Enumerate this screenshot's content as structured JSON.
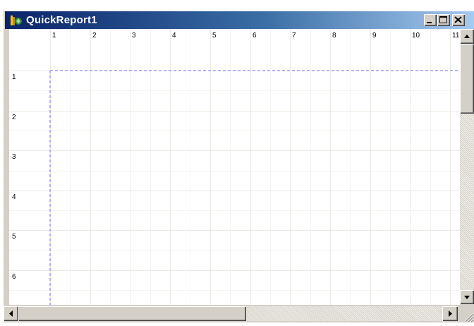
{
  "window": {
    "title": "QuickReport1",
    "icons": {
      "app": "delphi-app-icon",
      "minimize": "minimize-icon",
      "maximize": "maximize-icon",
      "close": "close-icon"
    }
  },
  "ruler": {
    "top": [
      "1",
      "2",
      "3",
      "4",
      "5",
      "6",
      "7",
      "8",
      "9",
      "10",
      "11"
    ],
    "left": [
      "1",
      "2",
      "3",
      "4",
      "5",
      "6"
    ]
  },
  "colors": {
    "title_gradient_start": "#0a246a",
    "title_gradient_end": "#a6caf0",
    "margin_guide": "#7070ff",
    "grid_line": "#ece9e4",
    "face": "#d4d0c8"
  },
  "scrollbars": {
    "vertical": {
      "icons": [
        "scroll-up-arrow-icon",
        "scroll-down-arrow-icon"
      ]
    },
    "horizontal": {
      "icons": [
        "scroll-left-arrow-icon",
        "scroll-right-arrow-icon"
      ]
    }
  }
}
